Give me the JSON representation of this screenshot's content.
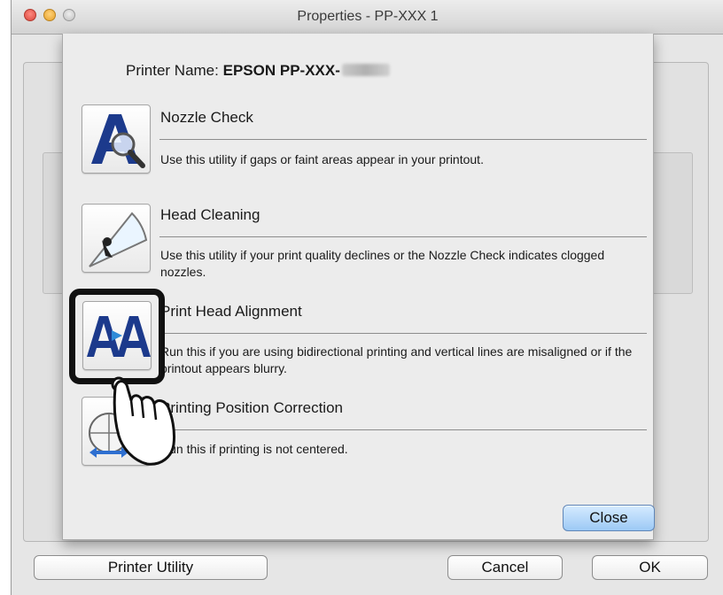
{
  "window": {
    "title": "Properties - PP-XXX 1",
    "buttons": {
      "printer_utility": "Printer Utility",
      "cancel": "Cancel",
      "ok": "OK"
    }
  },
  "sheet": {
    "printer_name_label": "Printer Name:",
    "printer_name_value": "EPSON PP-XXX-",
    "utilities": [
      {
        "icon": "nozzle-check-icon",
        "title": "Nozzle Check",
        "description": "Use this utility if gaps or faint areas appear in your printout."
      },
      {
        "icon": "head-cleaning-icon",
        "title": "Head Cleaning",
        "description": "Use this utility if your print quality declines or the Nozzle Check indicates clogged nozzles."
      },
      {
        "icon": "print-head-alignment-icon",
        "title": "Print Head Alignment",
        "description": "Run this if you are using bidirectional printing and vertical lines are misaligned or if the printout appears blurry."
      },
      {
        "icon": "printing-position-correction-icon",
        "title": "Printing Position Correction",
        "description": "Run this if printing is not centered."
      }
    ],
    "close_label": "Close"
  },
  "colors": {
    "icon_blue": "#1c3a8c",
    "close_button": "#9cc9f5",
    "highlight": "#111111"
  }
}
